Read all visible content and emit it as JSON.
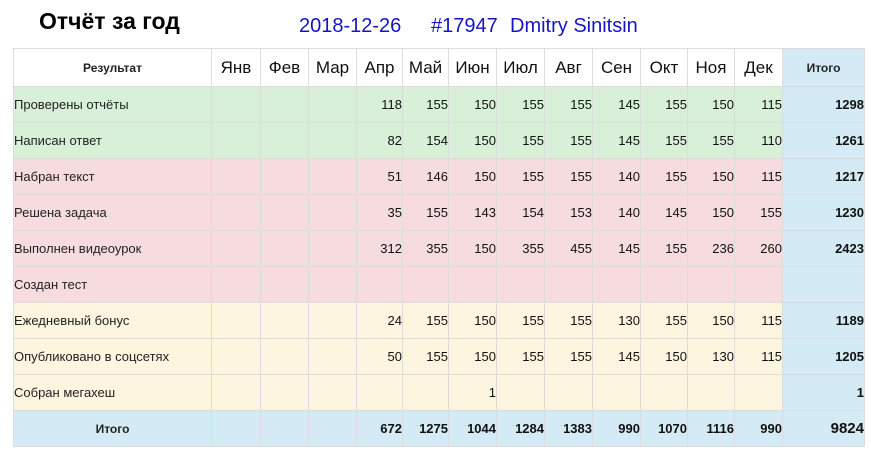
{
  "header": {
    "title": "Отчёт за год",
    "date": "2018-12-26",
    "id": "#17947",
    "user": "Dmitry Sinitsin"
  },
  "table": {
    "label_header": "Результат",
    "total_header": "Итого",
    "months": [
      "Янв",
      "Фев",
      "Мар",
      "Апр",
      "Май",
      "Июн",
      "Июл",
      "Авг",
      "Сен",
      "Окт",
      "Ноя",
      "Дек"
    ],
    "rows": [
      {
        "label": "Проверены отчёты",
        "group": "green",
        "values": [
          "",
          "",
          "",
          "118",
          "155",
          "150",
          "155",
          "155",
          "145",
          "155",
          "150",
          "115"
        ],
        "total": "1298"
      },
      {
        "label": "Написан ответ",
        "group": "green",
        "values": [
          "",
          "",
          "",
          "82",
          "154",
          "150",
          "155",
          "155",
          "145",
          "155",
          "155",
          "110"
        ],
        "total": "1261"
      },
      {
        "label": "Набран текст",
        "group": "pink",
        "values": [
          "",
          "",
          "",
          "51",
          "146",
          "150",
          "155",
          "155",
          "140",
          "155",
          "150",
          "115"
        ],
        "total": "1217"
      },
      {
        "label": "Решена задача",
        "group": "pink",
        "values": [
          "",
          "",
          "",
          "35",
          "155",
          "143",
          "154",
          "153",
          "140",
          "145",
          "150",
          "155"
        ],
        "total": "1230"
      },
      {
        "label": "Выполнен видеоурок",
        "group": "pink",
        "values": [
          "",
          "",
          "",
          "312",
          "355",
          "150",
          "355",
          "455",
          "145",
          "155",
          "236",
          "260"
        ],
        "total": "2423"
      },
      {
        "label": "Создан тест",
        "group": "pink",
        "values": [
          "",
          "",
          "",
          "",
          "",
          "",
          "",
          "",
          "",
          "",
          "",
          ""
        ],
        "total": ""
      },
      {
        "label": "Ежедневный бонус",
        "group": "cream",
        "values": [
          "",
          "",
          "",
          "24",
          "155",
          "150",
          "155",
          "155",
          "130",
          "155",
          "150",
          "115"
        ],
        "total": "1189"
      },
      {
        "label": "Опубликовано в соцсетях",
        "group": "cream",
        "values": [
          "",
          "",
          "",
          "50",
          "155",
          "150",
          "155",
          "155",
          "145",
          "150",
          "130",
          "115"
        ],
        "total": "1205"
      },
      {
        "label": "Собран мегахеш",
        "group": "cream",
        "values": [
          "",
          "",
          "",
          "",
          "",
          "1",
          "",
          "",
          "",
          "",
          "",
          ""
        ],
        "total": "1"
      }
    ],
    "totals": {
      "label": "Итого",
      "values": [
        "",
        "",
        "",
        "672",
        "1275",
        "1044",
        "1284",
        "1383",
        "990",
        "1070",
        "1116",
        "990"
      ],
      "grand_total": "9824"
    }
  },
  "colors": {
    "green_group": "#d8f0d8",
    "pink_group": "#f6dcdf",
    "cream_group": "#fdf5e0",
    "total_column": "#d4ebf5",
    "meta_text": "#1515c8"
  }
}
